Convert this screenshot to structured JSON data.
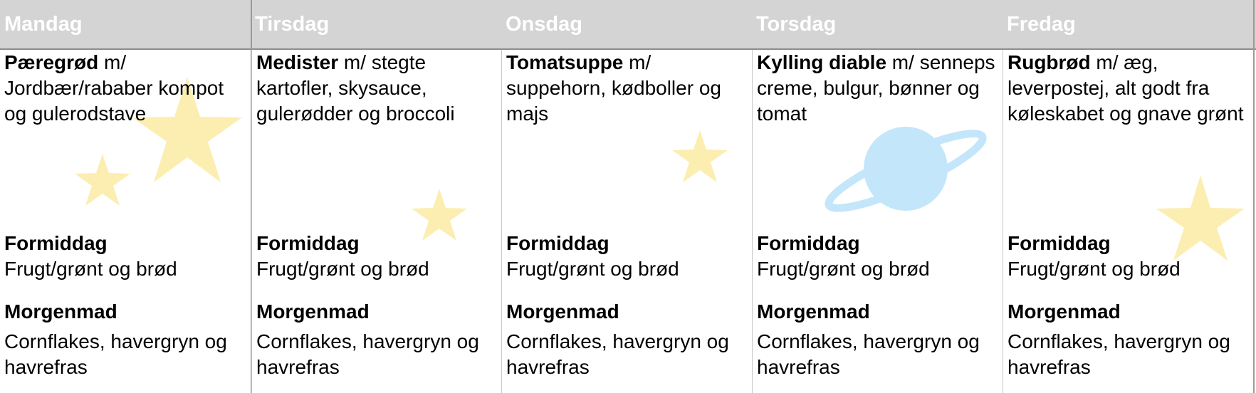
{
  "days": [
    {
      "name": "Mandag",
      "dish_bold": "Pæregrød",
      "dish_rest": " m/ Jordbær/rababer kompot og gulerodstave"
    },
    {
      "name": "Tirsdag",
      "dish_bold": "Medister",
      "dish_rest": " m/ stegte kartofler, skysauce, gulerødder og broccoli"
    },
    {
      "name": "Onsdag",
      "dish_bold": "Tomatsuppe",
      "dish_rest": " m/ suppehorn, kødboller og majs"
    },
    {
      "name": "Torsdag",
      "dish_bold": "Kylling diable",
      "dish_rest": " m/ senneps creme, bulgur, bønner og tomat"
    },
    {
      "name": "Fredag",
      "dish_bold": "Rugbrød",
      "dish_rest": " m/ æg, leverpostej, alt godt fra køleskabet og gnave grønt"
    }
  ],
  "snack": {
    "title": "Formiddag",
    "text": "Frugt/grønt og brød"
  },
  "breakfast": {
    "title": "Morgenmad",
    "text": "Cornflakes, havergryn og havrefras"
  },
  "decorations": [
    "star-icon",
    "star-icon",
    "star-icon",
    "star-icon",
    "planet-icon",
    "star-icon"
  ],
  "colors": {
    "header_bg": "#d4d4d4",
    "header_text": "#ffffff",
    "star": "#fbeeb0",
    "planet": "#c4e6fb"
  }
}
